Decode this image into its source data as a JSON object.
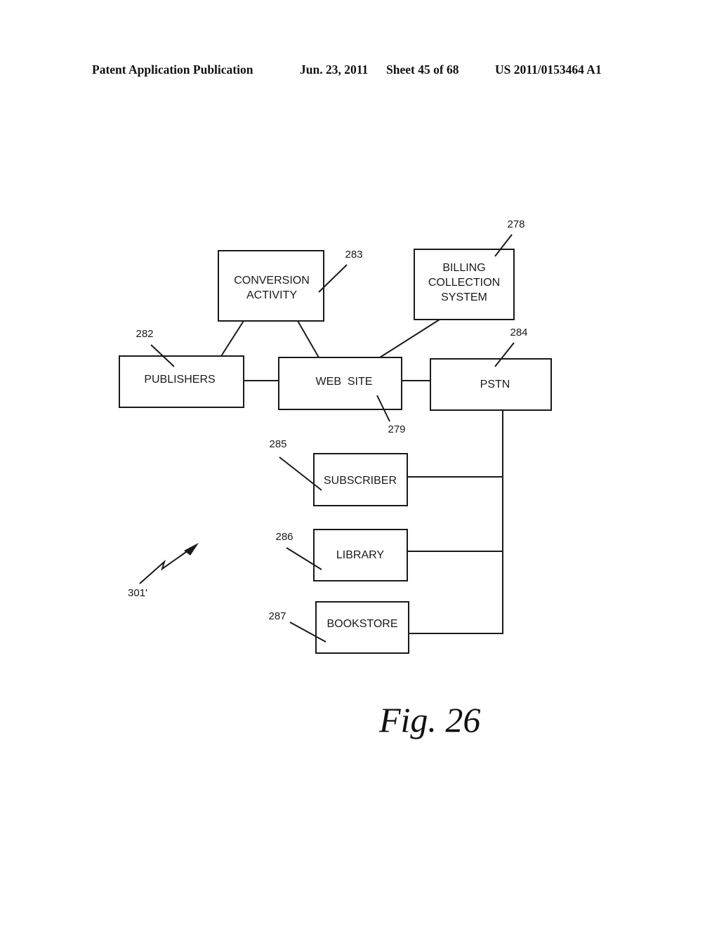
{
  "header": {
    "publication": "Patent Application Publication",
    "date": "Jun. 23, 2011",
    "sheet": "Sheet 45 of 68",
    "number": "US 2011/0153464 A1"
  },
  "figure": {
    "label": "Fig. 26",
    "boxes": {
      "conversion_activity": {
        "lines": [
          "CONVERSION",
          "ACTIVITY"
        ],
        "ref": "283"
      },
      "billing_collection": {
        "lines": [
          "BILLING",
          "COLLECTION",
          "SYSTEM"
        ],
        "ref": "278"
      },
      "publishers": {
        "lines": [
          "PUBLISHERS"
        ],
        "ref": "282"
      },
      "web_site": {
        "lines": [
          "WEB  SITE"
        ],
        "ref": "279"
      },
      "pstn": {
        "lines": [
          "PSTN"
        ],
        "ref": "284"
      },
      "subscriber": {
        "lines": [
          "SUBSCRIBER"
        ],
        "ref": "285"
      },
      "library": {
        "lines": [
          "LIBRARY"
        ],
        "ref": "286"
      },
      "bookstore": {
        "lines": [
          "BOOKSTORE"
        ],
        "ref": "287"
      }
    },
    "wireless_ref": "301'",
    "connections": [
      [
        "conversion_activity",
        "publishers"
      ],
      [
        "conversion_activity",
        "web_site"
      ],
      [
        "billing_collection",
        "web_site"
      ],
      [
        "publishers",
        "web_site"
      ],
      [
        "web_site",
        "pstn"
      ],
      [
        "pstn",
        "subscriber"
      ],
      [
        "pstn",
        "library"
      ],
      [
        "pstn",
        "bookstore"
      ]
    ]
  }
}
